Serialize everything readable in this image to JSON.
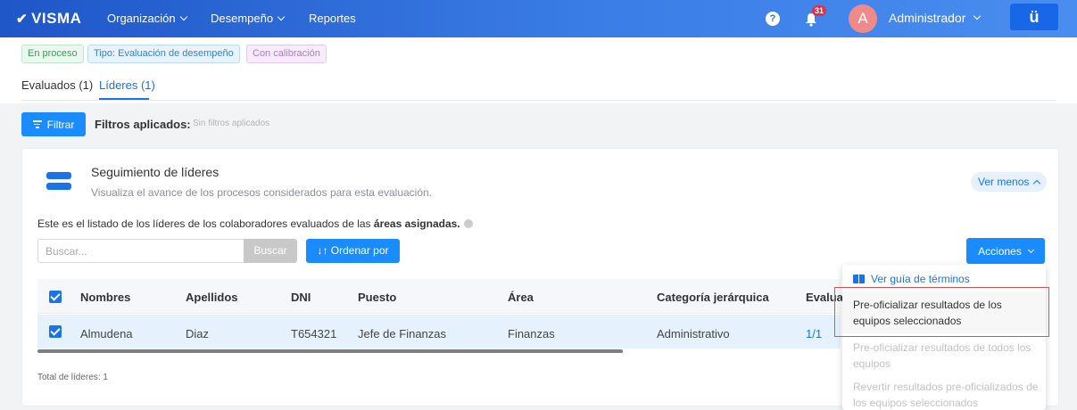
{
  "topbar": {
    "logo": "VISMA",
    "nav": [
      {
        "label": "Organización",
        "has_dropdown": true
      },
      {
        "label": "Desempeño",
        "has_dropdown": true
      },
      {
        "label": "Reportes",
        "has_dropdown": false
      }
    ],
    "notification_count": "31",
    "avatar_initial": "A",
    "user_name": "Administrador",
    "brand_glyph": "ü",
    "colors": {
      "bar_start": "#1f56c8",
      "bar_end": "#4a8df0",
      "badge": "#e0314b"
    }
  },
  "tags": [
    "En proceso",
    "Tipo: Evaluación de desempeño",
    "Con calibración"
  ],
  "tabs": [
    {
      "label": "Evaluados (1)",
      "active": false
    },
    {
      "label": "Líderes (1)",
      "active": true
    }
  ],
  "filters": {
    "button_label": "Filtrar",
    "applied_label": "Filtros aplicados:",
    "applied_value": "Sin filtros aplicados"
  },
  "card": {
    "icon": "server-icon",
    "title": "Seguimiento de líderes",
    "subtitle": "Visualiza el avance de los procesos considerados para esta evaluación.",
    "toggle_label": "Ver menos"
  },
  "list": {
    "description_prefix": "Este es el listado de los líderes de los colaboradores evaluados de las ",
    "description_bold": "áreas asignadas.",
    "search_placeholder": "Buscar...",
    "search_button": "Buscar",
    "sort_button": "↓↑ Ordenar por",
    "actions_button": "Acciones"
  },
  "table": {
    "headers": [
      "Nombres",
      "Apellidos",
      "DNI",
      "Puesto",
      "Área",
      "Categoría jerárquica",
      "Evaluaci"
    ],
    "rows": [
      {
        "checked": true,
        "cells": [
          "Almudena",
          "Diaz",
          "T654321",
          "Jefe de Finanzas",
          "Finanzas",
          "Administrativo",
          "1/1"
        ]
      }
    ],
    "total": "Total de líderes: 1"
  },
  "actions_menu": {
    "guide": "Ver guía de términos",
    "items": [
      {
        "label": "Pre-oficializar resultados de los equipos seleccionados",
        "enabled": true,
        "highlighted": true
      },
      {
        "label": "Pre-oficializar resultados de todos los equipos",
        "enabled": false
      },
      {
        "label": "Revertir resultados pre-oficializados de los equipos seleccionados",
        "enabled": false
      }
    ]
  }
}
